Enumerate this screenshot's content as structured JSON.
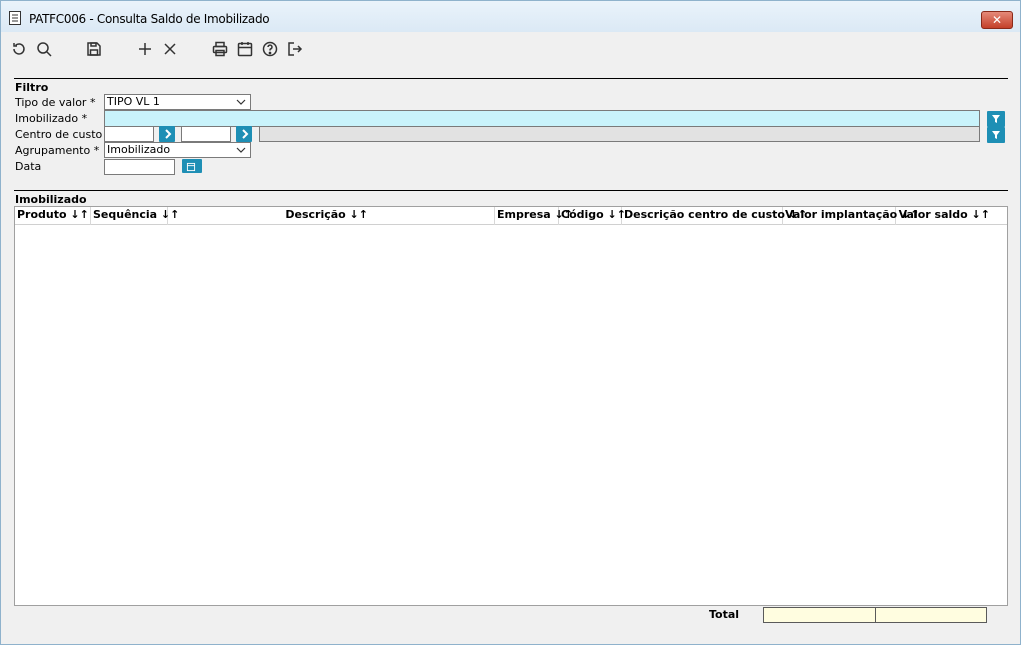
{
  "window": {
    "title": "PATFC006 - Consulta Saldo de Imobilizado",
    "close_label": "✕"
  },
  "toolbar": {
    "buttons": [
      "refresh-icon",
      "search-icon",
      "save-icon",
      "add-icon",
      "delete-icon",
      "print-icon",
      "calendar-icon",
      "help-icon",
      "exit-icon"
    ]
  },
  "filter": {
    "section_title": "Filtro",
    "tipo_valor": {
      "label": "Tipo de valor *",
      "value": "TIPO VL 1"
    },
    "imobilizado": {
      "label": "Imobilizado *",
      "value": ""
    },
    "centro_custo": {
      "label": "Centro de custo",
      "from": "",
      "to": "",
      "description": ""
    },
    "agrupamento": {
      "label": "Agrupamento *",
      "value": "Imobilizado"
    },
    "data": {
      "label": "Data",
      "value": ""
    }
  },
  "grid": {
    "section_title": "Imobilizado",
    "columns": [
      "Produto ↓↑",
      "Sequência ↓↑",
      "Descrição ↓↑",
      "Empresa ↓↑",
      "Código ↓↑",
      "Descrição centro de custo ↓↑",
      "Valor implantação ↓↑",
      "Valor saldo ↓↑"
    ],
    "rows": []
  },
  "totals": {
    "label": "Total",
    "valor_implantacao": "",
    "valor_saldo": ""
  },
  "colors": {
    "accent": "#1e8fb5",
    "required_input": "#c9f3fb",
    "total_bg": "#fffde0"
  }
}
